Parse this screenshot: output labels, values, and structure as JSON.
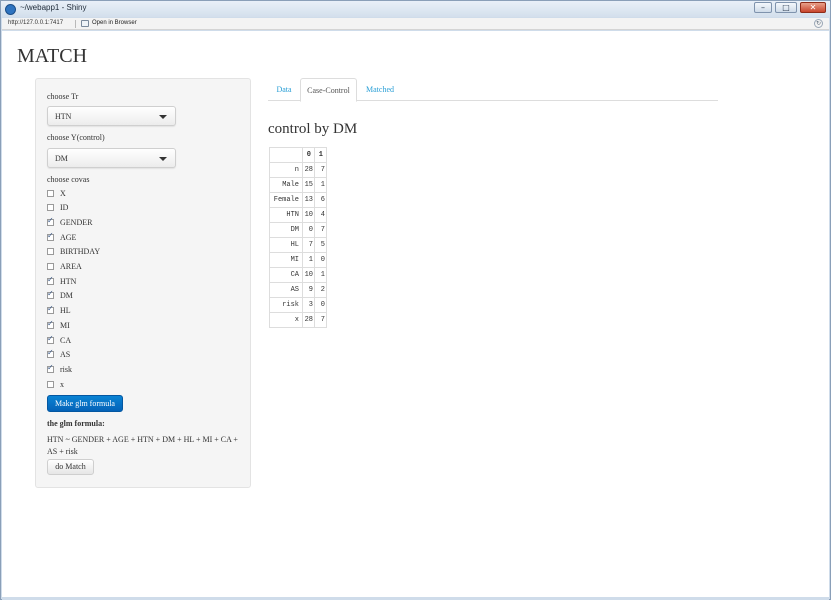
{
  "window": {
    "title": "~/webapp1 - Shiny",
    "minimize": "–",
    "restore": "□",
    "close": "✕"
  },
  "addressbar": {
    "url": "http://127.0.0.1:7417",
    "open_in_browser": "Open in Browser",
    "refresh_icon": "↻"
  },
  "app_title": "MATCH",
  "sidebar": {
    "tr_label": "choose Tr",
    "tr_value": "HTN",
    "y_label": "choose Y(control)",
    "y_value": "DM",
    "covas_label": "choose covas",
    "covas": [
      {
        "label": "X",
        "checked": false
      },
      {
        "label": "ID",
        "checked": false
      },
      {
        "label": "GENDER",
        "checked": true
      },
      {
        "label": "AGE",
        "checked": true
      },
      {
        "label": "BIRTHDAY",
        "checked": false
      },
      {
        "label": "AREA",
        "checked": false
      },
      {
        "label": "HTN",
        "checked": true
      },
      {
        "label": "DM",
        "checked": true
      },
      {
        "label": "HL",
        "checked": true
      },
      {
        "label": "MI",
        "checked": true
      },
      {
        "label": "CA",
        "checked": true
      },
      {
        "label": "AS",
        "checked": true
      },
      {
        "label": "risk",
        "checked": true
      },
      {
        "label": "x",
        "checked": false
      }
    ],
    "make_formula_button": "Make glm formula",
    "formula_label": "the glm formula:",
    "formula_text": "HTN ~ GENDER + AGE + HTN + DM + HL + MI + CA + AS + risk",
    "do_match_button": "do Match"
  },
  "tabs": [
    {
      "label": "Data",
      "active": false
    },
    {
      "label": "Case-Control",
      "active": true
    },
    {
      "label": "Matched",
      "active": false
    }
  ],
  "main": {
    "title": "control by DM",
    "table": {
      "columns": [
        "0",
        "1"
      ],
      "rows": [
        {
          "name": "n",
          "values": [
            "28",
            "7"
          ]
        },
        {
          "name": "Male",
          "values": [
            "15",
            "1"
          ]
        },
        {
          "name": "Female",
          "values": [
            "13",
            "6"
          ]
        },
        {
          "name": "HTN",
          "values": [
            "10",
            "4"
          ]
        },
        {
          "name": "DM",
          "values": [
            "0",
            "7"
          ]
        },
        {
          "name": "HL",
          "values": [
            "7",
            "5"
          ]
        },
        {
          "name": "MI",
          "values": [
            "1",
            "0"
          ]
        },
        {
          "name": "CA",
          "values": [
            "10",
            "1"
          ]
        },
        {
          "name": "AS",
          "values": [
            "9",
            "2"
          ]
        },
        {
          "name": "risk",
          "values": [
            "3",
            "0"
          ]
        },
        {
          "name": "x",
          "values": [
            "28",
            "7"
          ]
        }
      ]
    }
  }
}
